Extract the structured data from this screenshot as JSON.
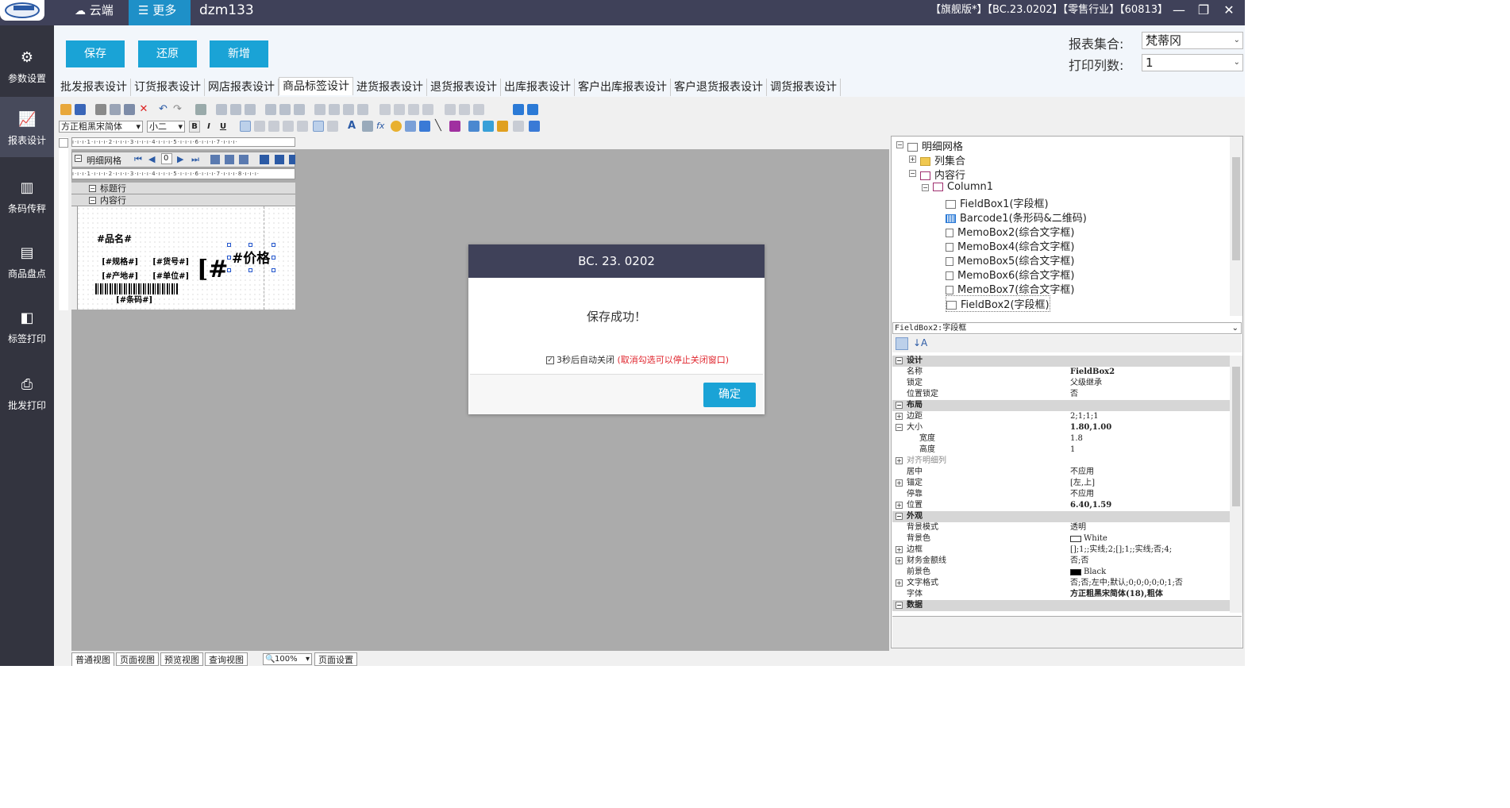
{
  "topbar": {
    "cloud_label": "云端",
    "more_label": "更多",
    "user": "dzm133",
    "edition": "【旗舰版*】【BC.23.0202】【零售行业】【60813】"
  },
  "sidebar": [
    {
      "label": "参数设置",
      "icon": "gear-icon"
    },
    {
      "label": "报表设计",
      "icon": "chart-icon"
    },
    {
      "label": "条码传秤",
      "icon": "barcode-icon"
    },
    {
      "label": "商品盘点",
      "icon": "inventory-icon"
    },
    {
      "label": "标签打印",
      "icon": "tag-icon"
    },
    {
      "label": "批发打印",
      "icon": "printer-icon"
    }
  ],
  "actions": {
    "save": "保存",
    "restore": "还原",
    "add": "新增"
  },
  "report_set": {
    "label": "报表集合:",
    "value": "梵蒂冈"
  },
  "print_cols": {
    "label": "打印列数:",
    "value": "1"
  },
  "tabs": [
    "批发报表设计",
    "订货报表设计",
    "网店报表设计",
    "商品标签设计",
    "进货报表设计",
    "退货报表设计",
    "出库报表设计",
    "客户出库报表设计",
    "客户退货报表设计",
    "调货报表设计"
  ],
  "font": {
    "name": "方正粗黑宋简体",
    "size": "小二"
  },
  "designer": {
    "grid_title": "明细网格",
    "page_num": "0",
    "band_title": "标题行",
    "band_content": "内容行",
    "fields": {
      "name": "#品名#",
      "spec": "[#规格#]",
      "code": "[#货号#]",
      "origin": "[#产地#]",
      "unit": "[#单位#]",
      "price": "#价格",
      "big": "[#",
      "barcode": "[#条码#]"
    }
  },
  "dialog": {
    "title": "BC. 23. 0202",
    "message": "保存成功！",
    "auto_close": "3秒后自动关闭",
    "hint": "(取消勾选可以停止关闭窗口)",
    "ok": "确定"
  },
  "tree": [
    "明细网格",
    "列集合",
    "内容行",
    "Column1",
    "FieldBox1(字段框)",
    "Barcode1(条形码&二维码)",
    "MemoBox2(综合文字框)",
    "MemoBox4(综合文字框)",
    "MemoBox5(综合文字框)",
    "MemoBox6(综合文字框)",
    "MemoBox7(综合文字框)",
    "FieldBox2(字段框)"
  ],
  "prop_combo": "FieldBox2:字段框",
  "props": [
    {
      "k": "设计",
      "cat": true
    },
    {
      "k": "名称",
      "v": "FieldBox2"
    },
    {
      "k": "锁定",
      "v": "父级继承"
    },
    {
      "k": "位置锁定",
      "v": "否"
    },
    {
      "k": "布局",
      "cat": true
    },
    {
      "k": "边距",
      "v": "2;1;1;1",
      "exp": "+"
    },
    {
      "k": "大小",
      "v": "1.80,1.00",
      "exp": "-"
    },
    {
      "k": "宽度",
      "v": "1.8",
      "sub": true
    },
    {
      "k": "高度",
      "v": "1",
      "sub": true
    },
    {
      "k": "对齐明细列",
      "v": "",
      "exp": "+",
      "grey": true
    },
    {
      "k": "居中",
      "v": "不应用"
    },
    {
      "k": "锚定",
      "v": "[左,上]",
      "exp": "+"
    },
    {
      "k": "停靠",
      "v": "不应用"
    },
    {
      "k": "位置",
      "v": "6.40,1.59",
      "exp": "+"
    },
    {
      "k": "外观",
      "cat": true
    },
    {
      "k": "背景模式",
      "v": "透明"
    },
    {
      "k": "背景色",
      "v": "White",
      "swatch": "#ffffff"
    },
    {
      "k": "边框",
      "v": "[];1;;实线;2;[];1;;实线;否;4;",
      "exp": "+"
    },
    {
      "k": "财务金额线",
      "v": "否;否",
      "exp": "+"
    },
    {
      "k": "前景色",
      "v": "Black",
      "swatch": "#000000"
    },
    {
      "k": "文字格式",
      "v": "否;否;左中;默认;0;0;0;0;0;1;否",
      "exp": "+"
    },
    {
      "k": "字体",
      "v": "方正粗黑宋简体(18),粗体"
    },
    {
      "k": "数据",
      "cat": true
    }
  ],
  "bottom_tabs": [
    "普通视图",
    "页面视图",
    "预览视图",
    "查询视图"
  ],
  "zoom": "100%",
  "page_setup": "页面设置"
}
